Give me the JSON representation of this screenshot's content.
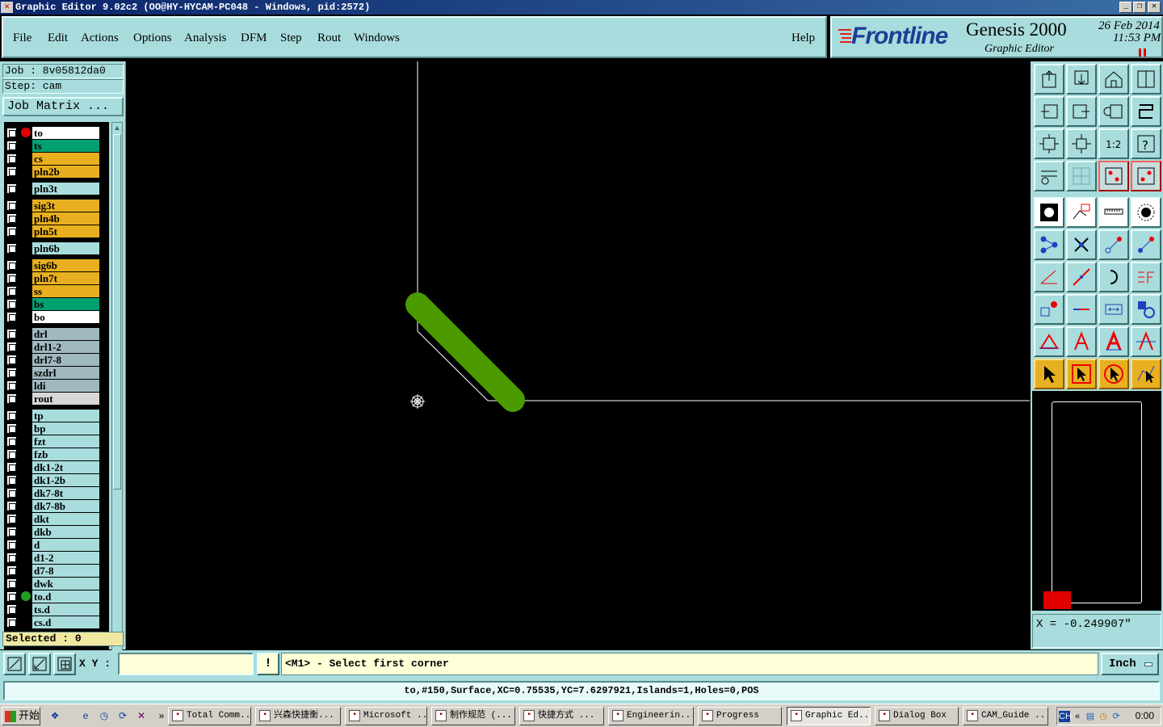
{
  "window": {
    "title": "Graphic Editor 9.02c2 (OO@HY-HYCAM-PC048 - Windows, pid:2572)",
    "controls": [
      "minimize",
      "restore",
      "close"
    ]
  },
  "menu": {
    "items": [
      "File",
      "Edit",
      "Actions",
      "Options",
      "Analysis",
      "DFM",
      "Step",
      "Rout",
      "Windows"
    ],
    "help": "Help"
  },
  "branding": {
    "logo": "Frontline",
    "product": "Genesis 2000",
    "subtitle": "Graphic Editor",
    "date": "26 Feb 2014",
    "time": "11:53 PM"
  },
  "job": {
    "job_label": "Job : 8v05812da0",
    "step_label": "Step: cam",
    "matrix_button": "Job Matrix ..."
  },
  "layers": [
    {
      "name": "to",
      "color": "#ffffff",
      "dot": "#e00000",
      "gap": false
    },
    {
      "name": "ts",
      "color": "#00a070",
      "dot": "",
      "gap": false
    },
    {
      "name": "cs",
      "color": "#e8b020",
      "dot": "",
      "gap": false
    },
    {
      "name": "pln2b",
      "color": "#e8b020",
      "dot": "",
      "gap": false
    },
    {
      "name": "pln3t",
      "color": "#a9dcdc",
      "dot": "",
      "gap": true
    },
    {
      "name": "sig3t",
      "color": "#e8b020",
      "dot": "",
      "gap": true
    },
    {
      "name": "pln4b",
      "color": "#e8b020",
      "dot": "",
      "gap": false
    },
    {
      "name": "pln5t",
      "color": "#e8b020",
      "dot": "",
      "gap": false
    },
    {
      "name": "pln6b",
      "color": "#a9dcdc",
      "dot": "",
      "gap": true
    },
    {
      "name": "sig6b",
      "color": "#e8b020",
      "dot": "",
      "gap": true
    },
    {
      "name": "pln7t",
      "color": "#e8b020",
      "dot": "",
      "gap": false
    },
    {
      "name": "ss",
      "color": "#e8b020",
      "dot": "",
      "gap": false
    },
    {
      "name": "bs",
      "color": "#00a070",
      "dot": "",
      "gap": false
    },
    {
      "name": "bo",
      "color": "#ffffff",
      "dot": "",
      "gap": false
    },
    {
      "name": "drl",
      "color": "#a0b8c0",
      "dot": "",
      "gap": true
    },
    {
      "name": "drl1-2",
      "color": "#a0b8c0",
      "dot": "",
      "gap": false
    },
    {
      "name": "drl7-8",
      "color": "#a0b8c0",
      "dot": "",
      "gap": false
    },
    {
      "name": "szdrl",
      "color": "#a0b8c0",
      "dot": "",
      "gap": false
    },
    {
      "name": "ldi",
      "color": "#a0b8c0",
      "dot": "",
      "gap": false
    },
    {
      "name": "rout",
      "color": "#d8d8d8",
      "dot": "",
      "gap": false
    },
    {
      "name": "tp",
      "color": "#a9dcdc",
      "dot": "",
      "gap": true
    },
    {
      "name": "bp",
      "color": "#a9dcdc",
      "dot": "",
      "gap": false
    },
    {
      "name": "fzt",
      "color": "#a9dcdc",
      "dot": "",
      "gap": false
    },
    {
      "name": "fzb",
      "color": "#a9dcdc",
      "dot": "",
      "gap": false
    },
    {
      "name": "dk1-2t",
      "color": "#a9dcdc",
      "dot": "",
      "gap": false
    },
    {
      "name": "dk1-2b",
      "color": "#a9dcdc",
      "dot": "",
      "gap": false
    },
    {
      "name": "dk7-8t",
      "color": "#a9dcdc",
      "dot": "",
      "gap": false
    },
    {
      "name": "dk7-8b",
      "color": "#a9dcdc",
      "dot": "",
      "gap": false
    },
    {
      "name": "dkt",
      "color": "#a9dcdc",
      "dot": "",
      "gap": false
    },
    {
      "name": "dkb",
      "color": "#a9dcdc",
      "dot": "",
      "gap": false
    },
    {
      "name": "d",
      "color": "#a9dcdc",
      "dot": "",
      "gap": false
    },
    {
      "name": "d1-2",
      "color": "#a9dcdc",
      "dot": "",
      "gap": false
    },
    {
      "name": "d7-8",
      "color": "#a9dcdc",
      "dot": "",
      "gap": false
    },
    {
      "name": "dwk",
      "color": "#a9dcdc",
      "dot": "",
      "gap": false
    },
    {
      "name": "to.d",
      "color": "#a9dcdc",
      "dot": "#20a020",
      "gap": false
    },
    {
      "name": "ts.d",
      "color": "#a9dcdc",
      "dot": "",
      "gap": false
    },
    {
      "name": "cs.d",
      "color": "#a9dcdc",
      "dot": "",
      "gap": false
    }
  ],
  "selected_label": "Selected : 0",
  "canvas": {
    "feature_color": "#4a9a00",
    "outline_color": "#ffffff"
  },
  "toolbar": {
    "icons": [
      "open-icon",
      "save-icon",
      "home-icon",
      "window-icon",
      "prev-icon",
      "next-icon",
      "undo-icon",
      "redo-icon",
      "zoom-fit-icon",
      "zoom-center-icon",
      "zoom-1to2-icon",
      "help-icon",
      "settings-icon",
      "grid-icon",
      "snap-icon",
      "snap-alt-icon",
      "camera-icon",
      "surface-icon",
      "ruler-icon",
      "pad-icon",
      "connect-icon",
      "delete-icon",
      "move-icon",
      "copy-icon",
      "angle-icon",
      "line-icon",
      "arc-icon",
      "mirror-icon",
      "transform-icon",
      "split-icon",
      "measure-icon",
      "shapes-icon",
      "triangle-icon",
      "text-icon",
      "text-outline-icon",
      "text-strike-icon",
      "select-icon",
      "select-box-icon",
      "select-circle-icon",
      "select-route-icon"
    ]
  },
  "coord_readout": "X = -0.249907\"",
  "command": {
    "xy_label": "X Y :",
    "xy_value": "",
    "warn": "!",
    "prompt": "<M1> - Select first corner",
    "unit": "Inch"
  },
  "status": "to,#150,Surface,XC=0.75535,YC=7.6297921,Islands=1,Holes=0,POS",
  "taskbar": {
    "start": "开始",
    "tasks": [
      {
        "label": "Total Comm...",
        "active": false
      },
      {
        "label": "兴森快捷衡...",
        "active": false
      },
      {
        "label": "Microsoft ...",
        "active": false
      },
      {
        "label": "制作规范 (...",
        "active": false
      },
      {
        "label": "快捷方式 ...",
        "active": false
      },
      {
        "label": "Engineerin...",
        "active": false
      },
      {
        "label": "Progress",
        "active": false
      },
      {
        "label": "Graphic Ed...",
        "active": true
      },
      {
        "label": "Dialog Box",
        "active": false
      },
      {
        "label": "CAM_Guide ...",
        "active": false
      }
    ],
    "tray_label": "CH",
    "clock": "0:00"
  }
}
